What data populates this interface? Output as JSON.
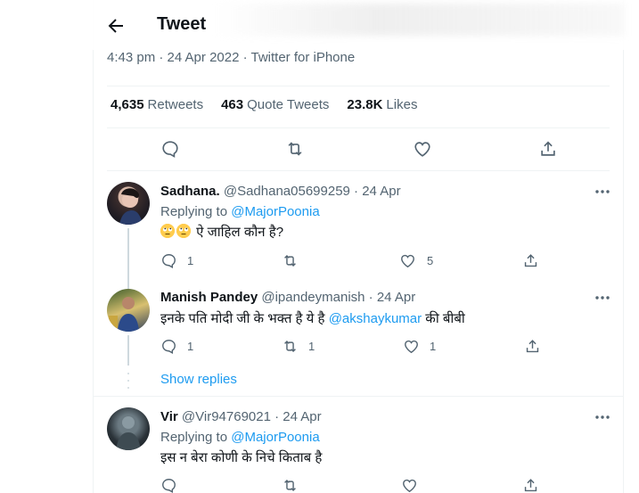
{
  "header": {
    "title": "Tweet"
  },
  "tweet": {
    "meta": "4:43 pm · 24 Apr 2022 · Twitter for iPhone",
    "stats": [
      {
        "count": "4,635",
        "label": "Retweets"
      },
      {
        "count": "463",
        "label": "Quote Tweets"
      },
      {
        "count": "23.8K",
        "label": "Likes"
      }
    ],
    "actions": [
      "reply-icon",
      "retweet-icon",
      "like-icon",
      "share-icon"
    ]
  },
  "replies": [
    {
      "name": "Sadhana.",
      "handle": "@Sadhana05699259 · 24 Apr",
      "replying_prefix": "Replying to",
      "replying_to": "@MajorPoonia",
      "text": "ऐ जाहिल कौन है?",
      "emojis": [
        "face-with-rolling-eyes",
        "face-with-rolling-eyes"
      ],
      "reply_count": "1",
      "retweet_count": "",
      "like_count": "5"
    },
    {
      "name": "Manish Pandey",
      "handle": "@ipandeymanish · 24 Apr",
      "text_before": "इनके पति मोदी जी के भक्त है ये है",
      "mention": "@akshaykumar",
      "text_after": "की बीबी",
      "reply_count": "1",
      "retweet_count": "1",
      "like_count": "1",
      "show_replies": "Show replies"
    },
    {
      "name": "Vir",
      "handle": "@Vir94769021 · 24 Apr",
      "replying_prefix": "Replying to",
      "replying_to": "@MajorPoonia",
      "text": "इस न बेरा कोणी के निचे किताब है",
      "reply_count": "",
      "retweet_count": "",
      "like_count": ""
    }
  ]
}
